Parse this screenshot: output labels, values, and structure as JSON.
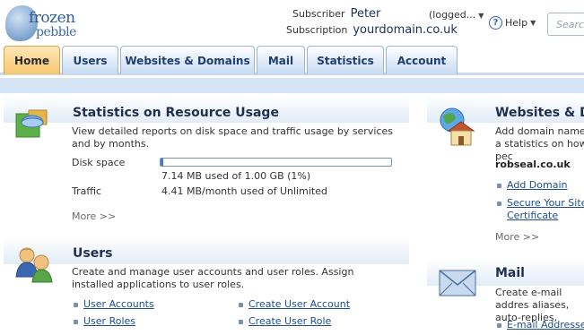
{
  "logo": {
    "line1": "frozen",
    "line2": "pebble"
  },
  "header": {
    "subscriber_label": "Subscriber",
    "subscriber_name": "Peter",
    "subscription_label": "Subscription",
    "subscription_value": "yourdomain.co.uk",
    "logged_text": "(logged...",
    "help_label": "Help",
    "search_placeholder": "Search"
  },
  "tabs": [
    "Home",
    "Users",
    "Websites & Domains",
    "Mail",
    "Statistics",
    "Account"
  ],
  "stats": {
    "title": "Statistics on Resource Usage",
    "desc": "View detailed reports on disk space and traffic usage by services and by months.",
    "disk_label": "Disk space",
    "disk_value": "7.14 MB used of 1.00 GB (1%)",
    "disk_percent": 1,
    "traffic_label": "Traffic",
    "traffic_value": "4.41 MB/month used of Unlimited",
    "more": "More >>"
  },
  "users": {
    "title": "Users",
    "desc": "Create and manage user accounts and user roles. Assign installed applications to user roles.",
    "links": [
      "User Accounts",
      "User Roles",
      "Create User Account",
      "Create User Role"
    ]
  },
  "websites": {
    "title": "Websites & Do",
    "desc": "Add domain names a statistics on how pec",
    "domain": "robseal.co.uk",
    "links": [
      "Add Domain",
      "Secure Your Site wi",
      "Certificate"
    ],
    "more": "More >>"
  },
  "mail": {
    "title": "Mail",
    "desc": "Create e-mail addres aliases, auto-replies,",
    "links": [
      "E-mail Addresses"
    ]
  }
}
